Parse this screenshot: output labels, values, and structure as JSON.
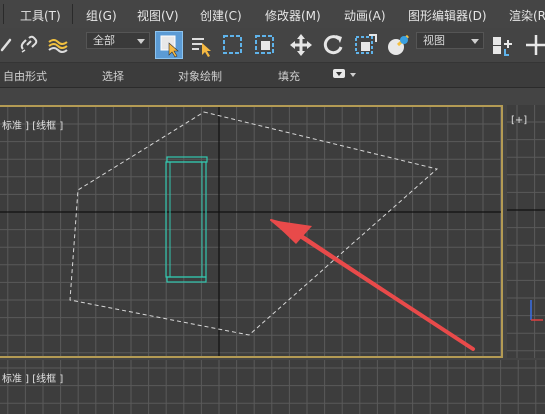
{
  "menu": {
    "items": [
      {
        "label": "工具(T)"
      },
      {
        "label": "组(G)"
      },
      {
        "label": "视图(V)"
      },
      {
        "label": "创建(C)"
      },
      {
        "label": "修改器(M)"
      },
      {
        "label": "动画(A)"
      },
      {
        "label": "图形编辑器(D)"
      },
      {
        "label": "渲染(R"
      }
    ]
  },
  "toolbar": {
    "selection_filter": "全部",
    "reference_coord": "视图"
  },
  "ribbon": {
    "tabs": [
      {
        "label": "自由形式"
      },
      {
        "label": "选择"
      },
      {
        "label": "对象绘制"
      },
      {
        "label": "填充"
      }
    ]
  },
  "viewports": {
    "main_label": "标准 ] [线框 ]",
    "right_label": "[+]",
    "bottom_label": "标准 ] [线框 ]"
  },
  "colors": {
    "accent_active": "#5b9bd5",
    "viewport_border": "#b49b54",
    "object_wire": "#32c8b0",
    "arrow": "#e84a4a"
  },
  "icons": [
    "bind-icon",
    "unlink-icon",
    "space-warp-icon",
    "select-object-icon",
    "select-by-name-icon",
    "rect-selection-icon",
    "window-crossing-icon",
    "move-icon",
    "rotate-icon",
    "scale-icon",
    "ref-coord-icon",
    "pivot-icon",
    "mirror-icon"
  ]
}
